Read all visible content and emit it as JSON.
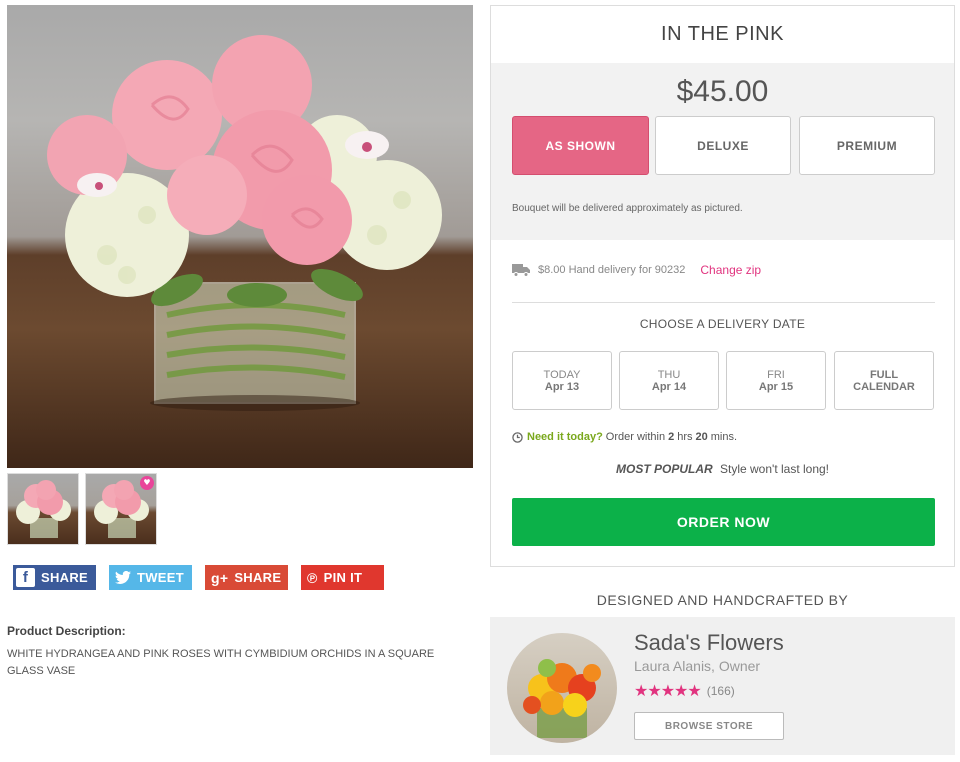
{
  "product": {
    "name": "IN THE PINK",
    "price": "$45.00",
    "options": [
      "AS SHOWN",
      "DELUXE",
      "PREMIUM"
    ],
    "selected_option": "AS SHOWN",
    "note": "Bouquet will be delivered approximately as pictured."
  },
  "gallery": {
    "main_image": "pink-roses-hydrangea-bouquet",
    "thumbnails": [
      "bouquet-thumb",
      "bouquet-thumb-deluxe"
    ],
    "thumb_badge_icon": "heart-icon"
  },
  "share": {
    "facebook": "SHARE",
    "twitter": "TWEET",
    "googleplus": "SHARE",
    "pinterest": "PIN IT"
  },
  "description": {
    "title": "Product Description:",
    "text": "WHITE HYDRANGEA AND PINK ROSES WITH CYMBIDIUM ORCHIDS IN A SQUARE GLASS VASE"
  },
  "delivery": {
    "info": "$8.00 Hand delivery for 90232",
    "change_zip": "Change zip",
    "choose_title": "CHOOSE A DELIVERY DATE",
    "dates": [
      {
        "day": "TODAY",
        "date": "Apr 13"
      },
      {
        "day": "THU",
        "date": "Apr 14"
      },
      {
        "day": "FRI",
        "date": "Apr 15"
      }
    ],
    "calendar_line1": "FULL",
    "calendar_line2": "CALENDAR"
  },
  "urgency": {
    "need_label": "Need it today?",
    "order_within": "Order within",
    "hours": "2",
    "hrs_label": "hrs",
    "mins": "20",
    "mins_label": "mins."
  },
  "popular": {
    "label": "MOST POPULAR",
    "text": "Style won't last long!"
  },
  "order_button": "ORDER NOW",
  "florist": {
    "section_title": "DESIGNED AND HANDCRAFTED BY",
    "name": "Sada's Flowers",
    "owner": "Laura Alanis, Owner",
    "rating": 5,
    "stars": "★★★★★",
    "reviews": "(166)",
    "browse": "BROWSE STORE"
  },
  "colors": {
    "accent_pink": "#e56685",
    "link_pink": "#e1347f",
    "order_green": "#0cb149",
    "need_green": "#7aa81c",
    "facebook": "#3b5a9a",
    "twitter": "#55b7e8",
    "googleplus": "#d94a36",
    "pinterest": "#e0372e"
  }
}
